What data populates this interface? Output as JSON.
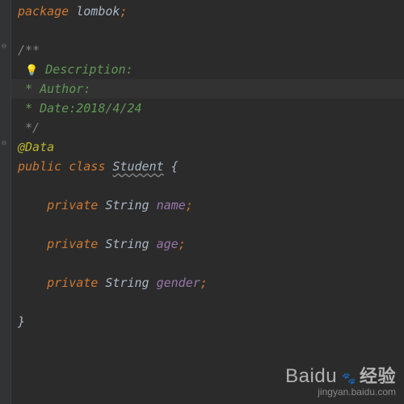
{
  "code": {
    "package_kw": "package",
    "package_name": "lombok",
    "javadoc_open": "/**",
    "bulb": "💡",
    "desc_line": " Description:",
    "author_line": " * Author:",
    "date_line": " * Date:2018/4/24",
    "javadoc_close": " */",
    "annotation": "@Data",
    "public_kw": "public",
    "class_kw": "class",
    "class_name": "Student",
    "open_brace": "{",
    "close_brace": "}",
    "private_kw": "private",
    "type_string": "String",
    "field_name": "name",
    "field_age": "age",
    "field_gender": "gender",
    "semicolon": ";"
  },
  "watermark": {
    "brand": "Baidu",
    "brand_zh": "经验",
    "url": "jingyan.baidu.com"
  }
}
